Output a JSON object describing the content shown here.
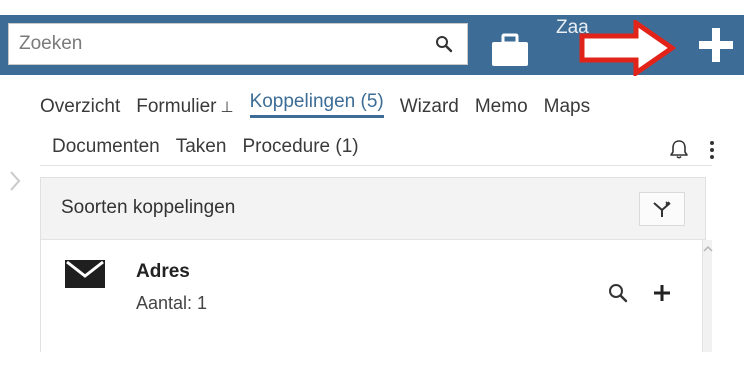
{
  "search": {
    "placeholder": "Zoeken",
    "value": "",
    "icon": "search-icon"
  },
  "header": {
    "partial_label": "Zaa",
    "briefcase_icon": "briefcase-icon",
    "add_icon": "plus-icon",
    "annotation": "red-arrow-pointing-right",
    "colors": {
      "bar": "#3d6d96",
      "annotation": "#e2231a"
    }
  },
  "tabs": {
    "row1": [
      {
        "label": "Overzicht",
        "active": false
      },
      {
        "label": "Formulier",
        "active": false,
        "pinned": true
      },
      {
        "label": "Koppelingen (5)",
        "active": true
      },
      {
        "label": "Wizard",
        "active": false
      },
      {
        "label": "Memo",
        "active": false
      },
      {
        "label": "Maps",
        "active": false
      }
    ],
    "row2": [
      {
        "label": "Documenten"
      },
      {
        "label": "Taken"
      },
      {
        "label": "Procedure (1)"
      }
    ],
    "pin_glyph": "⊥",
    "accent": "#3d6d96"
  },
  "panel": {
    "title": "Soorten koppelingen",
    "filter_icon": "filter-clear-icon",
    "rows": [
      {
        "title": "Adres",
        "count": "Aantal: 1",
        "icon": "envelope-icon"
      }
    ]
  }
}
